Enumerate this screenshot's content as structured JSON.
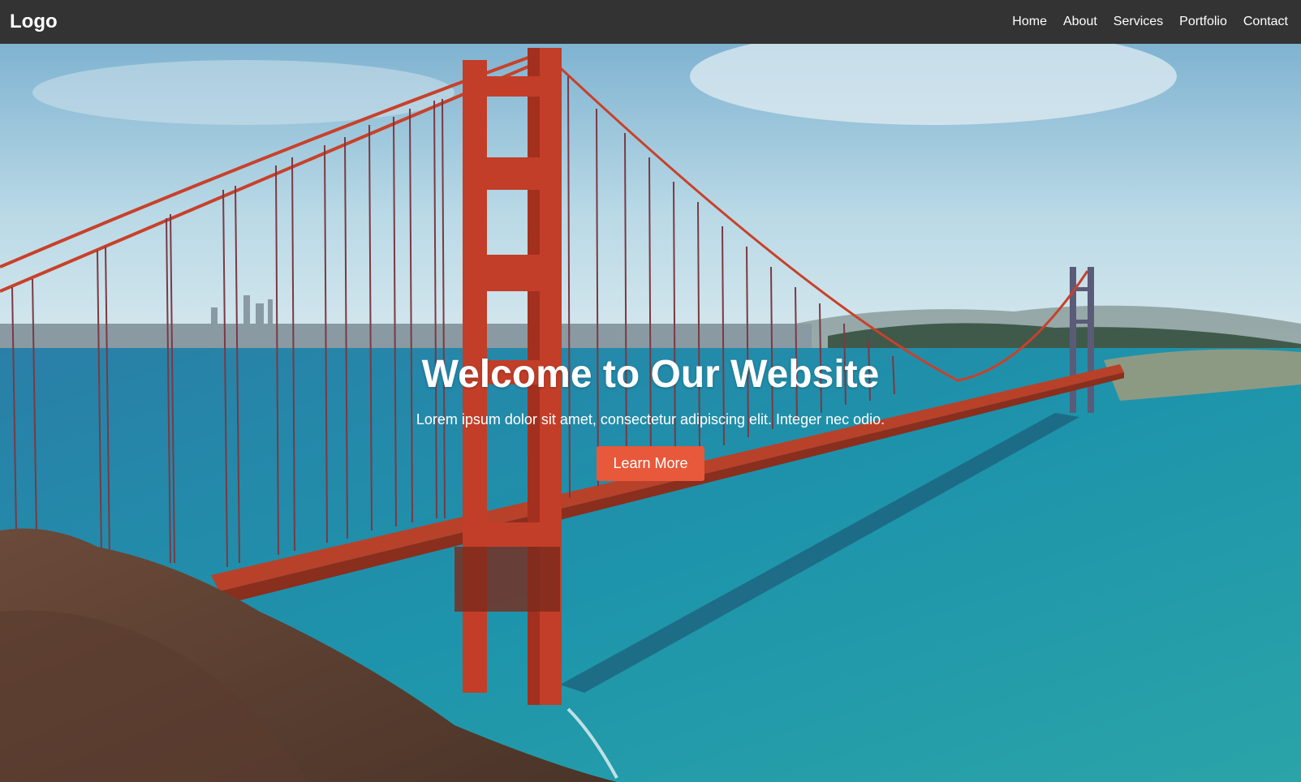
{
  "header": {
    "logo": "Logo",
    "nav": [
      {
        "label": "Home"
      },
      {
        "label": "About"
      },
      {
        "label": "Services"
      },
      {
        "label": "Portfolio"
      },
      {
        "label": "Contact"
      }
    ]
  },
  "hero": {
    "title": "Welcome to Our Website",
    "subtitle": "Lorem ipsum dolor sit amet, consectetur adipiscing elit. Integer nec odio.",
    "button_label": "Learn More"
  },
  "colors": {
    "navbar_bg": "#333333",
    "accent": "#e8583a",
    "bridge": "#c8412a",
    "water": "#1f8fa8",
    "sky": "#a9cfe0"
  }
}
